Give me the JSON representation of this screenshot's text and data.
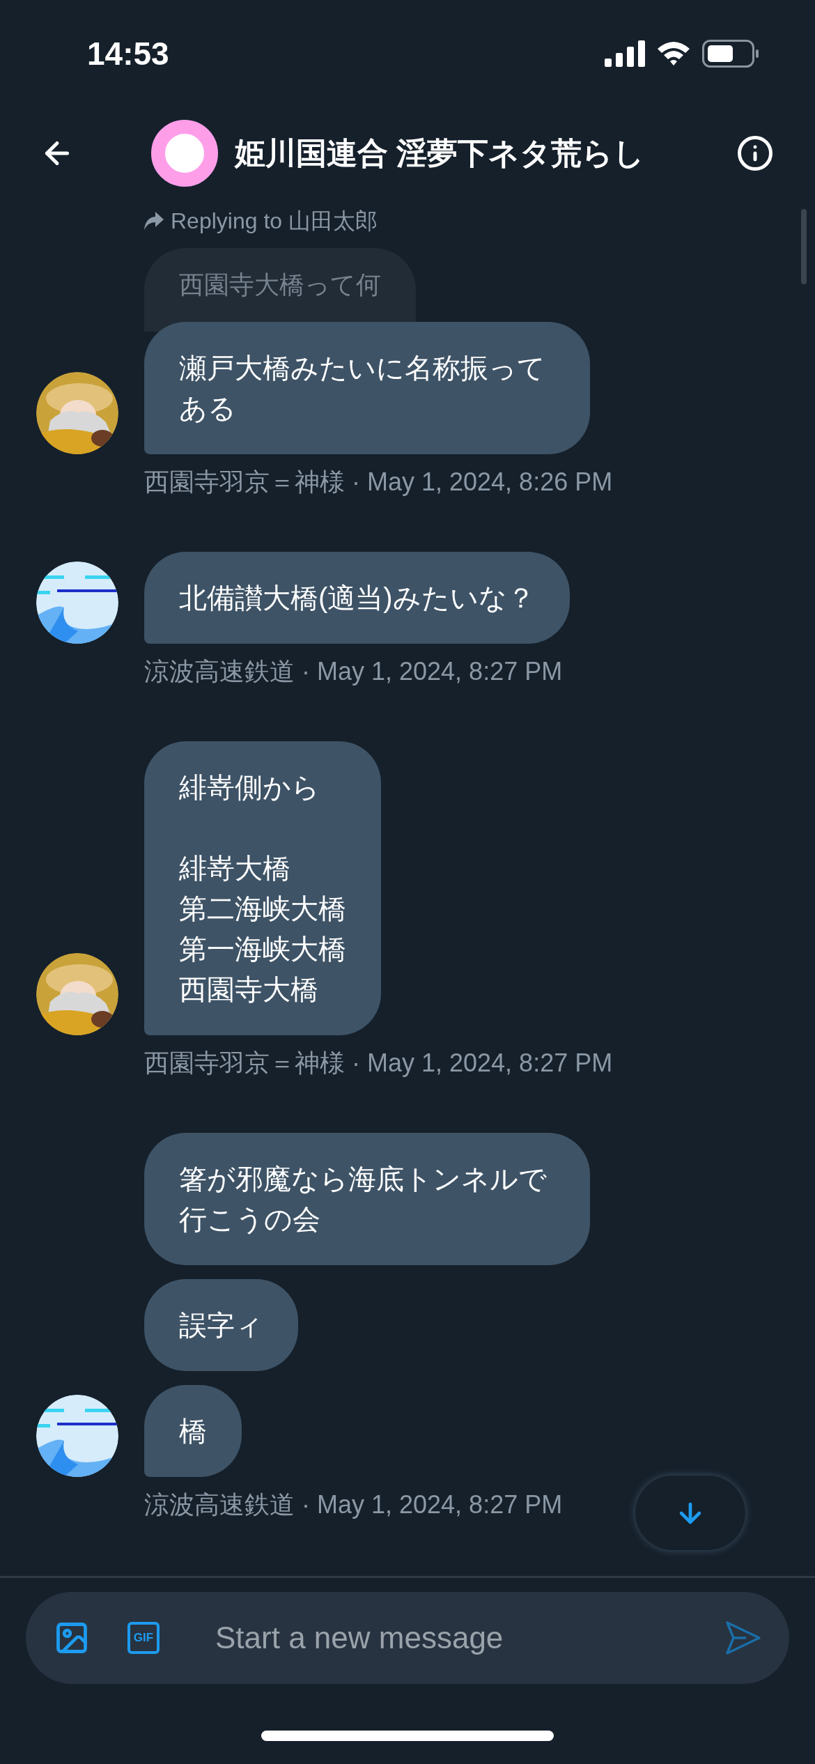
{
  "status_bar": {
    "time": "14:53"
  },
  "header": {
    "title": "姫川国連合 淫夢下ネタ荒らし",
    "reply_label": "Replying to 山田太郎"
  },
  "groups": [
    {
      "kind": "character",
      "quote": "西園寺大橋って何",
      "messages": [
        {
          "paragraphs": [
            [
              "瀬戸大橋みたいに名称振ってある"
            ]
          ]
        }
      ],
      "meta": "西園寺羽京＝神様 · May 1, 2024, 8:26 PM"
    },
    {
      "kind": "waves",
      "messages": [
        {
          "paragraphs": [
            [
              "北備讃大橋(適当)みたいな？"
            ]
          ]
        }
      ],
      "meta": "涼波高速鉄道 · May 1, 2024, 8:27 PM"
    },
    {
      "kind": "character",
      "messages": [
        {
          "paragraphs": [
            [
              "緋嵜側から"
            ],
            [
              "緋嵜大橋",
              "第二海峡大橋",
              "第一海峡大橋",
              "西園寺大橋"
            ]
          ]
        }
      ],
      "meta": "西園寺羽京＝神様 · May 1, 2024, 8:27 PM"
    },
    {
      "kind": "waves",
      "messages": [
        {
          "paragraphs": [
            [
              "箸が邪魔なら海底トンネルで行こうの会"
            ]
          ]
        },
        {
          "paragraphs": [
            [
              "誤字ィ"
            ]
          ]
        },
        {
          "paragraphs": [
            [
              "橋"
            ]
          ]
        }
      ],
      "meta": "涼波高速鉄道 · May 1, 2024, 8:27 PM"
    }
  ],
  "composer": {
    "placeholder": "Start a new message",
    "gif_label": "GIF"
  }
}
